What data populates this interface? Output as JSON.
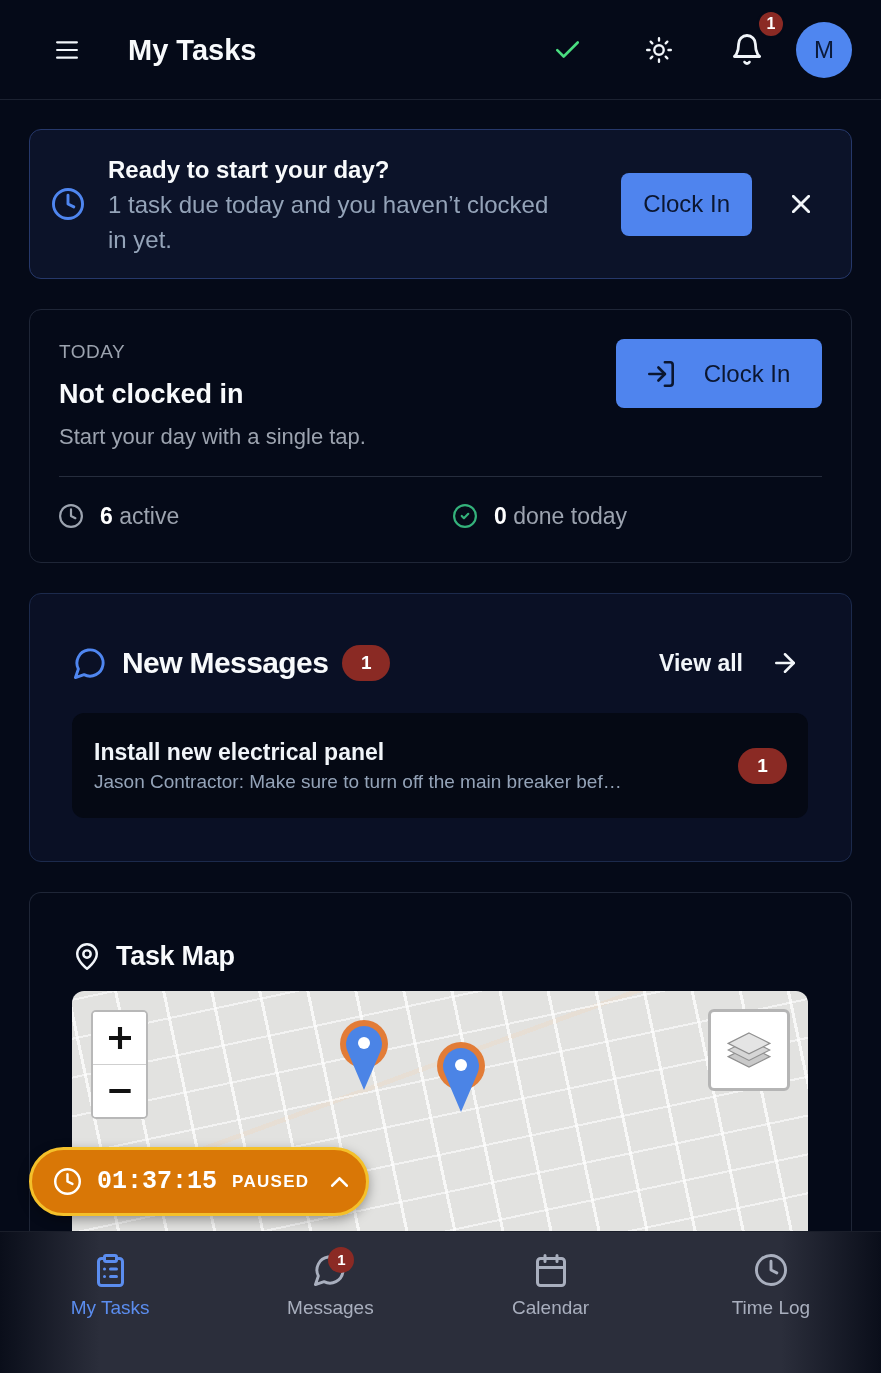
{
  "header": {
    "title": "My Tasks",
    "notification_count": "1",
    "avatar_initial": "M"
  },
  "banner": {
    "title": "Ready to start your day?",
    "text": "1 task due today and you haven’t clocked in yet.",
    "button": "Clock In"
  },
  "today": {
    "label": "TODAY",
    "status": "Not clocked in",
    "hint": "Start your day with a single tap.",
    "button": "Clock In",
    "stats": [
      {
        "kind": "active",
        "text": "**6** active"
      },
      {
        "kind": "done",
        "text": "**0** done today"
      }
    ]
  },
  "messages": {
    "title": "New Messages",
    "count": "1",
    "link": "View all",
    "items": [
      {
        "title": "Install new electrical panel",
        "preview": "Jason Contractor: Make sure to turn off the main breaker bef…",
        "count": "1"
      }
    ]
  },
  "map": {
    "title": "Task Map"
  },
  "timer": {
    "time": "01:37:15",
    "status": "PAUSED"
  },
  "bottom_nav": [
    {
      "kind": "tasks",
      "label": "My Tasks",
      "selected": true
    },
    {
      "kind": "messages",
      "label": "Messages",
      "selected": false,
      "badge": "1"
    },
    {
      "kind": "calendar",
      "label": "Calendar",
      "selected": false
    },
    {
      "kind": "timelog",
      "label": "Time Log",
      "selected": false
    }
  ]
}
